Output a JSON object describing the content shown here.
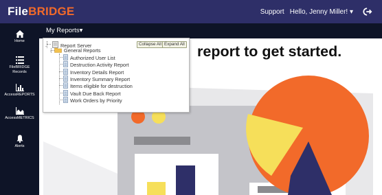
{
  "header": {
    "logo_part1": "File",
    "logo_part2": "BRIDGE",
    "support_label": "Support",
    "user_greeting": "Hello, Jenny Miller! ▾"
  },
  "sidebar": {
    "items": [
      {
        "label": "Home",
        "icon": "home-icon"
      },
      {
        "label": "FileBRIDGE Records",
        "icon": "list-icon"
      },
      {
        "label": "AccessREPORTS",
        "icon": "bar-chart-icon"
      },
      {
        "label": "AccessMETRICS",
        "icon": "area-chart-icon"
      },
      {
        "label": "Alerts",
        "icon": "bell-icon"
      }
    ]
  },
  "reports_bar": {
    "menu_label": "My Reports▾"
  },
  "main": {
    "prompt_text": "report to get started."
  },
  "tree": {
    "collapse_label": "Collapse All",
    "expand_label": "Expand All",
    "root": "Report Server",
    "folder": "General Reports",
    "reports": [
      "Authorized User List",
      "Destruction Activity Report",
      "Inventory Details Report",
      "Inventory Summary Report",
      "Items eligible for destruction",
      "Vault Due Back Report",
      "Work Orders by Priority"
    ]
  },
  "colors": {
    "topbar": "#2e2f68",
    "sidebar": "#0e1427",
    "brand_accent": "#f26a2a",
    "illustration_orange": "#f26a2a",
    "illustration_yellow": "#f6df5a",
    "illustration_navy": "#2e2f68"
  }
}
